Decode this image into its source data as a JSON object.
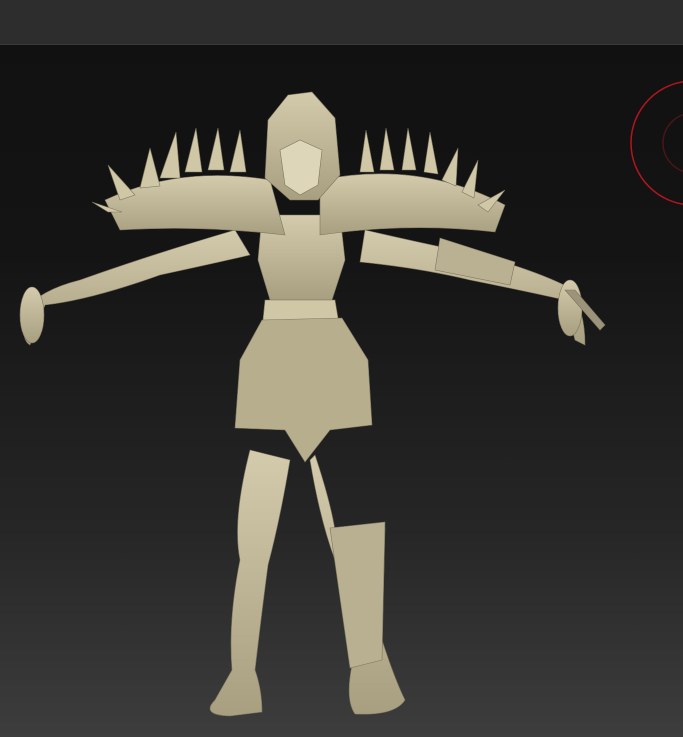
{
  "app": {
    "view": "3d-viewport"
  },
  "colors": {
    "toolbar": "#2d2d2d",
    "viewport_top": "#111111",
    "viewport_bottom": "#3d3d3d",
    "model": "#c8bf9d",
    "gizmo": "#b0161e"
  },
  "icons": [
    "rotation-gizmo-icon"
  ]
}
